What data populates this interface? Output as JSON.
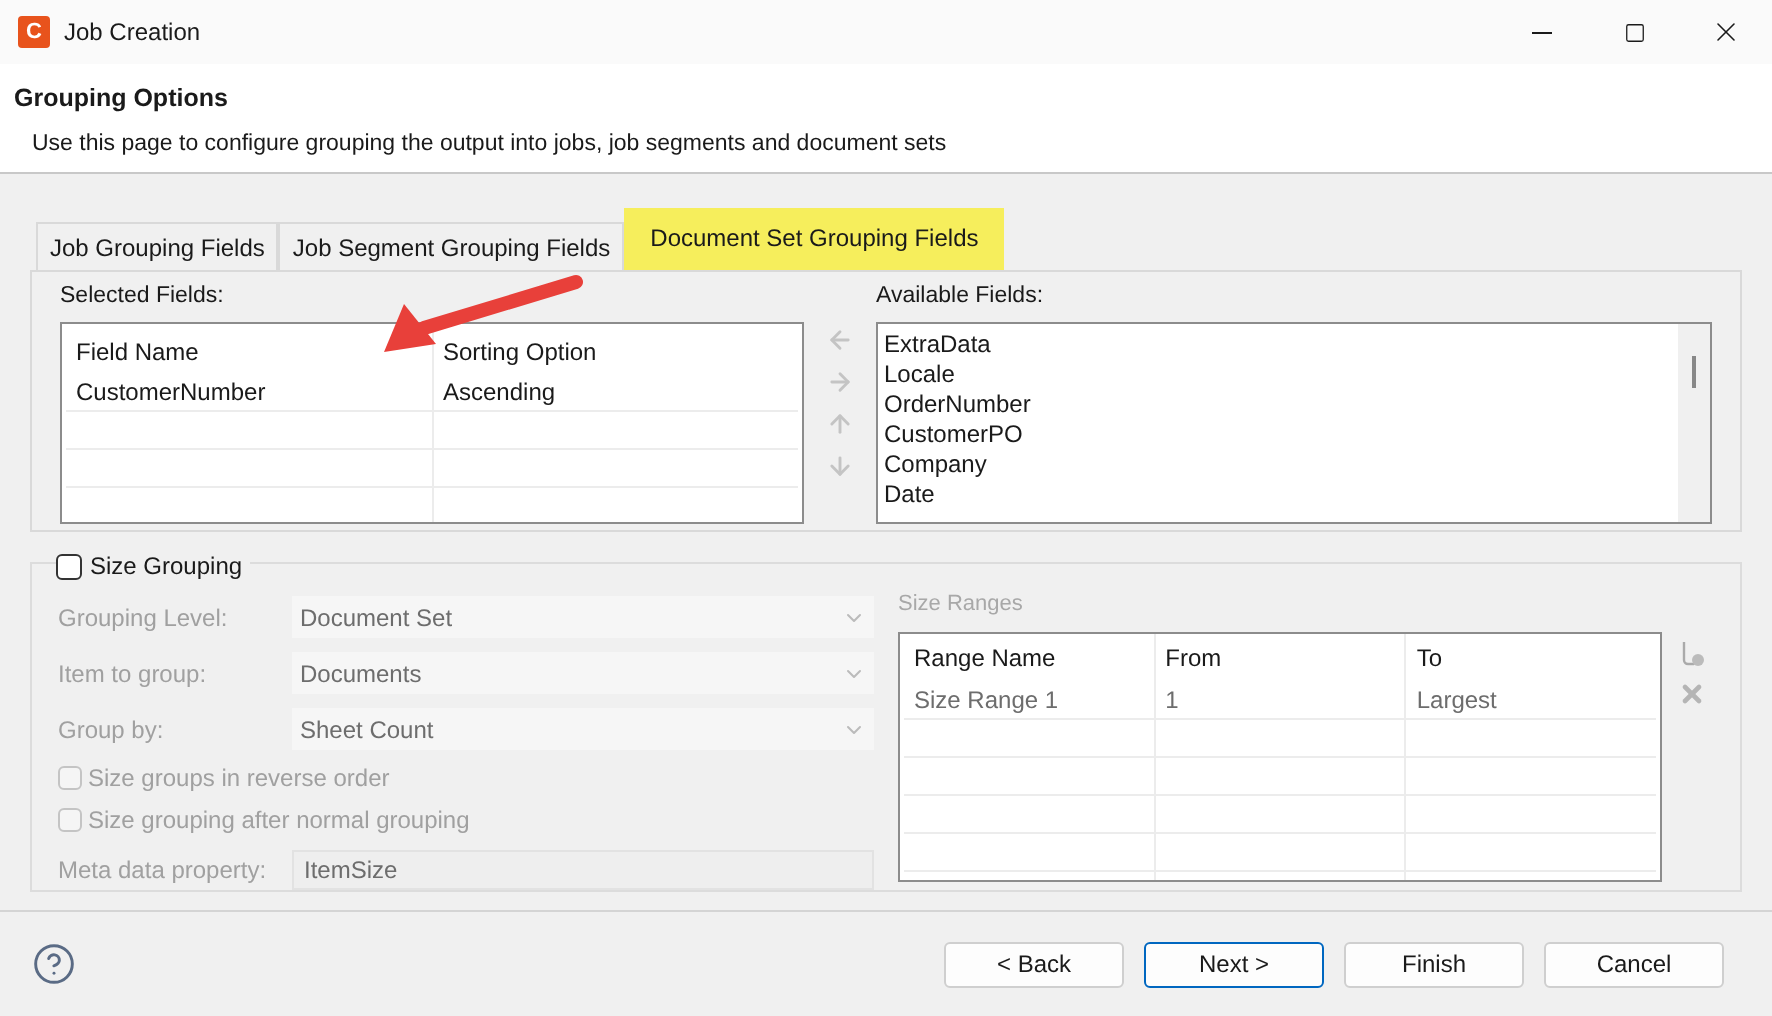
{
  "window": {
    "app_icon_letter": "C",
    "title": "Job Creation"
  },
  "header": {
    "title": "Grouping Options",
    "description": "Use this page to configure grouping the output into jobs, job segments and document sets"
  },
  "tabs": [
    {
      "label": "Job Grouping Fields",
      "selected": false
    },
    {
      "label": "Job Segment Grouping Fields",
      "selected": false
    },
    {
      "label": "Document Set Grouping Fields",
      "selected": true
    }
  ],
  "selected_fields": {
    "label": "Selected Fields:",
    "columns": [
      "Field Name",
      "Sorting Option"
    ],
    "rows": [
      [
        "CustomerNumber",
        "Ascending"
      ]
    ]
  },
  "move_buttons": [
    {
      "kind": "left",
      "disabled": true
    },
    {
      "kind": "right",
      "disabled": true
    },
    {
      "kind": "up",
      "disabled": true
    },
    {
      "kind": "down",
      "disabled": true
    }
  ],
  "available_fields": {
    "label": "Available Fields:",
    "items": [
      "ExtraData",
      "Locale",
      "OrderNumber",
      "CustomerPO",
      "Company",
      "Date"
    ]
  },
  "size_grouping": {
    "label": "Size Grouping",
    "checked": false,
    "fields": [
      {
        "kind": "dropdown",
        "label": "Grouping Level:",
        "value": "Document Set"
      },
      {
        "kind": "dropdown",
        "label": "Item to group:",
        "value": "Documents"
      },
      {
        "kind": "dropdown",
        "label": "Group by:",
        "value": "Sheet Count"
      },
      {
        "kind": "checkbox",
        "label": "Size groups in reverse order",
        "checked": false
      },
      {
        "kind": "checkbox",
        "label": "Size grouping after normal grouping",
        "checked": false
      },
      {
        "kind": "text",
        "label": "Meta data property:",
        "value": "ItemSize"
      }
    ],
    "size_ranges": {
      "label": "Size Ranges",
      "columns": [
        "Range Name",
        "From",
        "To"
      ],
      "rows": [
        [
          "Size Range 1",
          "1",
          "Largest"
        ]
      ]
    }
  },
  "buttons": [
    {
      "label": "< Back",
      "default": false
    },
    {
      "label": "Next >",
      "default": true
    },
    {
      "label": "Finish",
      "default": false
    },
    {
      "label": "Cancel",
      "default": false
    }
  ]
}
